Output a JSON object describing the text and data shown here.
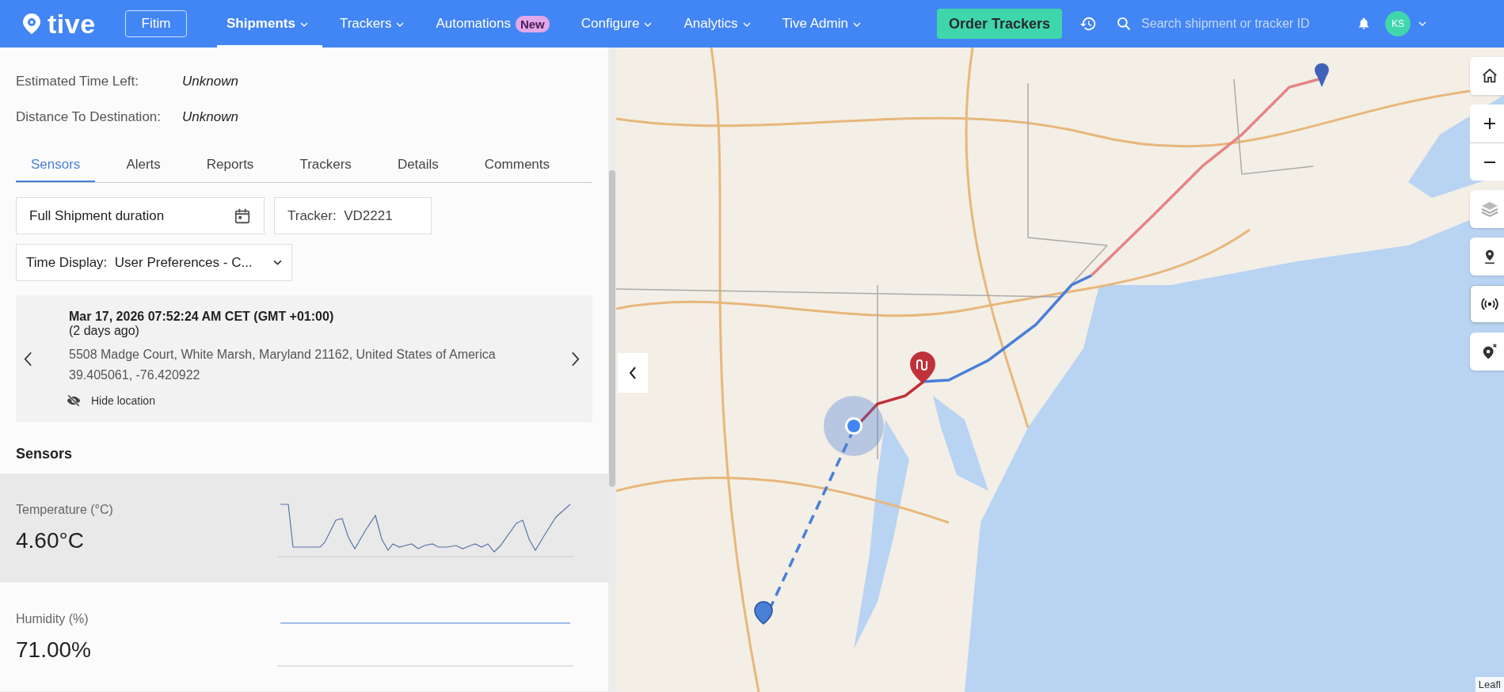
{
  "nav": {
    "logo": "tive",
    "account": "Fitim",
    "items": [
      {
        "label": "Shipments",
        "selected": true,
        "dropdown": true
      },
      {
        "label": "Trackers",
        "selected": false,
        "dropdown": true
      },
      {
        "label": "Automations",
        "selected": false,
        "dropdown": false,
        "badge": "New"
      },
      {
        "label": "Configure",
        "selected": false,
        "dropdown": true
      },
      {
        "label": "Analytics",
        "selected": false,
        "dropdown": true
      },
      {
        "label": "Tive Admin",
        "selected": false,
        "dropdown": true
      }
    ],
    "order_button": "Order Trackers",
    "search": {
      "placeholder": "Search shipment or tracker ID"
    },
    "avatar": "KS"
  },
  "summary": [
    {
      "label": "Estimated Time Left:",
      "value": "Unknown"
    },
    {
      "label": "Distance To Destination:",
      "value": "Unknown"
    }
  ],
  "tabs": [
    {
      "label": "Sensors",
      "selected": true
    },
    {
      "label": "Alerts",
      "selected": false
    },
    {
      "label": "Reports",
      "selected": false
    },
    {
      "label": "Trackers",
      "selected": false
    },
    {
      "label": "Details",
      "selected": false
    },
    {
      "label": "Comments",
      "selected": false
    }
  ],
  "filters": {
    "duration": "Full Shipment duration",
    "tracker_label": "Tracker:",
    "tracker": "VD2221",
    "time_display_label": "Time Display:",
    "time_display": "User Preferences - C..."
  },
  "location": {
    "timestamp": "Mar 17, 2026 07:52:24 AM CET (GMT +01:00)",
    "ago": "(2 days ago)",
    "address": "5508 Madge Court, White Marsh, Maryland 21162, United States of America",
    "coordinates": "39.405061, -76.420922",
    "hide_label": "Hide location"
  },
  "sensors": {
    "title": "Sensors",
    "items": [
      {
        "name": "Temperature (°C)",
        "value": "4.60°C",
        "kind": "varying",
        "hovered": true
      },
      {
        "name": "Humidity (%)",
        "value": "71.00%",
        "kind": "flat",
        "hovered": false
      }
    ]
  },
  "map": {
    "attribution": "Leafl"
  }
}
